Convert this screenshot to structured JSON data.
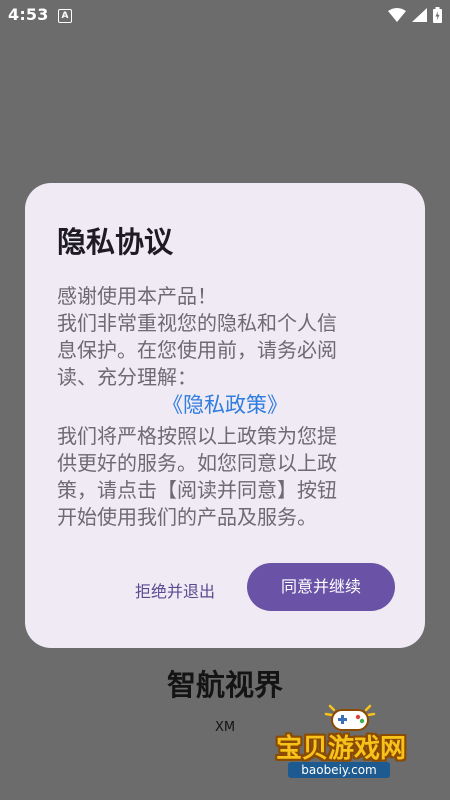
{
  "status_bar": {
    "time": "4:53",
    "notification_icon_letter": "A"
  },
  "dialog": {
    "title": "隐私协议",
    "intro_lines": [
      "感谢使用本产品！",
      "我们非常重视您的隐私和个人信",
      "息保护。在您使用前，请务必阅",
      "读、充分理解："
    ],
    "policy_link": "《隐私政策》",
    "detail_lines": [
      "我们将严格按照以上政策为您提",
      "供更好的服务。如您同意以上政",
      "策，请点击【阅读并同意】按钮",
      "开始使用我们的产品及服务。"
    ],
    "decline_label": "拒绝并退出",
    "agree_label": "同意并继续"
  },
  "app": {
    "name": "智航视界",
    "subtitle": "XM"
  },
  "watermark": {
    "brand": "宝贝游戏网",
    "url": "baobeiy.com"
  },
  "colors": {
    "overlay": "#6c6c6c",
    "dialog_bg": "#efeaf3",
    "accent": "#6a53a6",
    "link": "#2f7de1"
  }
}
